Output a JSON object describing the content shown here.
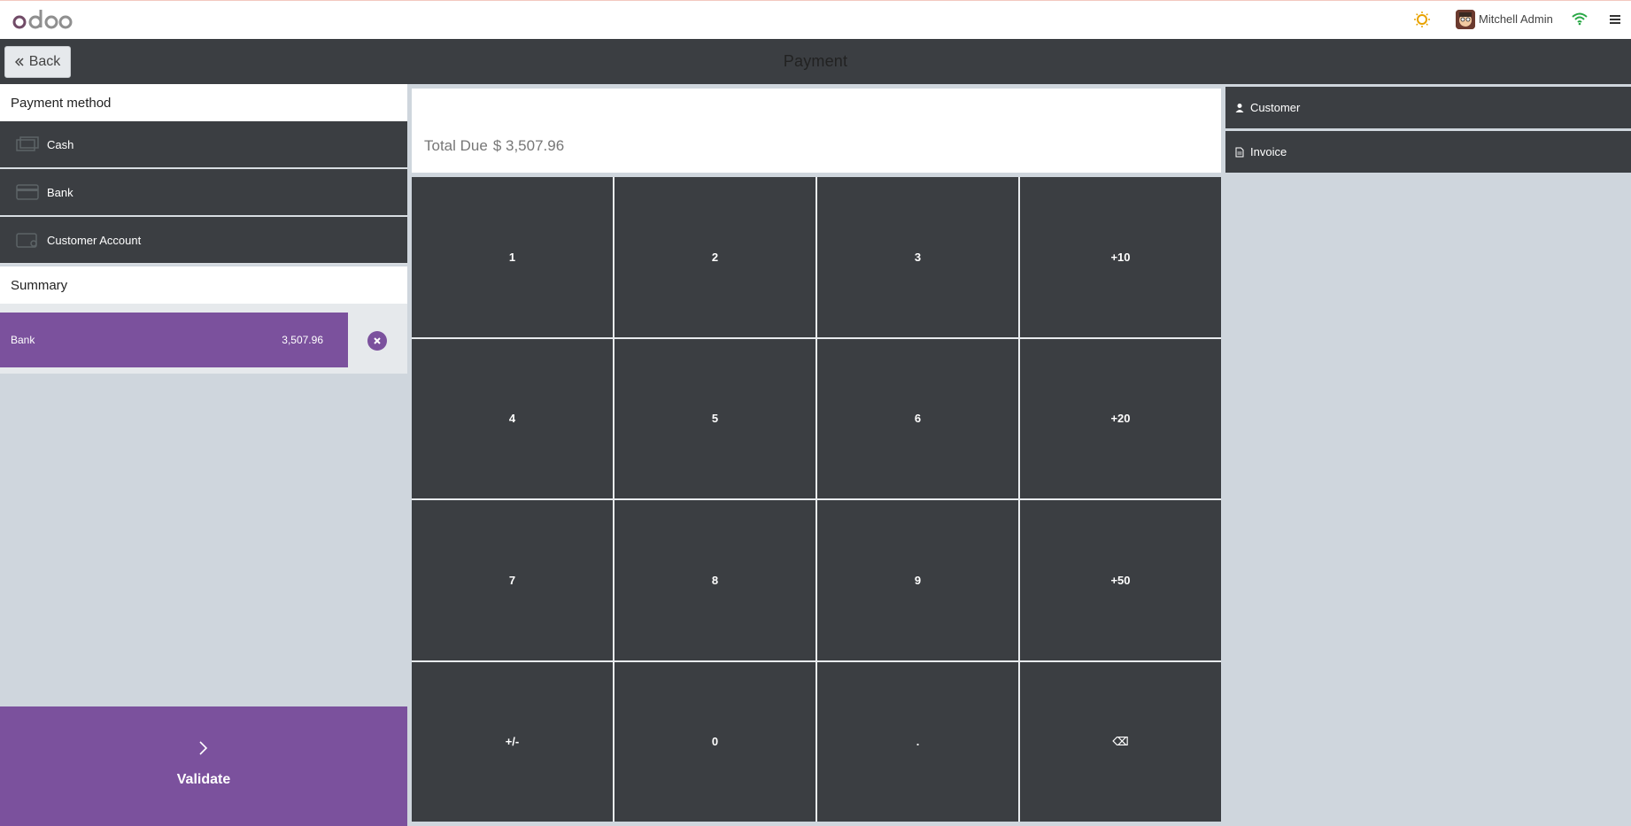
{
  "topbar": {
    "logo_text": "odoo",
    "user_name": "Mitchell Admin",
    "icons": [
      "sun-icon",
      "wifi-icon",
      "menu-icon"
    ]
  },
  "titlebar": {
    "back_label": "Back",
    "title": "Payment"
  },
  "payment_methods": {
    "header": "Payment method",
    "items": [
      {
        "label": "Cash",
        "icon": "cash-icon"
      },
      {
        "label": "Bank",
        "icon": "card-icon"
      },
      {
        "label": "Customer Account",
        "icon": "wallet-icon"
      }
    ]
  },
  "summary": {
    "header": "Summary",
    "lines": [
      {
        "method": "Bank",
        "amount": "3,507.96"
      }
    ]
  },
  "validate": {
    "label": "Validate"
  },
  "total_due": {
    "label": "Total Due",
    "amount": "$ 3,507.96"
  },
  "numpad": {
    "keys": [
      "1",
      "2",
      "3",
      "+10",
      "4",
      "5",
      "6",
      "+20",
      "7",
      "8",
      "9",
      "+50",
      "+/-",
      "0",
      ".",
      "⌫"
    ]
  },
  "right_panel": {
    "customer_label": "Customer",
    "invoice_label": "Invoice"
  },
  "colors": {
    "accent_purple": "#7b519d",
    "dark_panel": "#3b3e42",
    "background": "#cfd6dd"
  }
}
